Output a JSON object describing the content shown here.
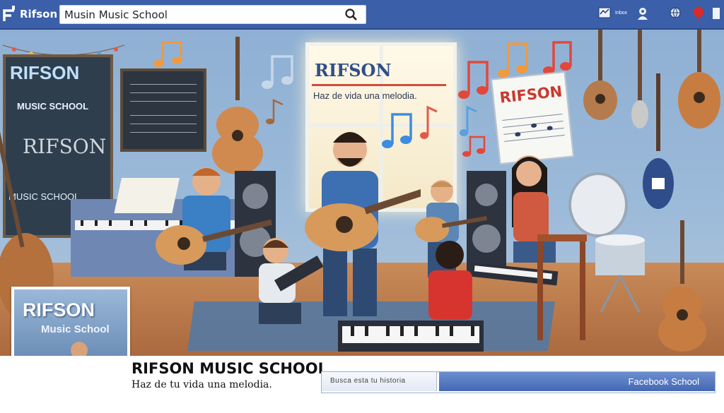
{
  "topbar": {
    "brand": "Rifson",
    "search_value": "Musin Music School",
    "nav_label": "Inbox"
  },
  "cover": {
    "window_title": "RIFSON",
    "window_tagline": "Haz de vida una melodia.",
    "chalkboard_title": "RIFSON",
    "chalkboard_subtitle": "MUSIC SCHOOL",
    "chalkboard_scribble": "RIFSON",
    "chalkboard_footer": "MUSIC SCHOOL",
    "sign_text": "RIFSON"
  },
  "profile": {
    "title": "RIFSON",
    "subtitle": "Music School"
  },
  "info": {
    "page_name": "RIFSON MUSIC SCHOOL",
    "tagline": "Haz de tu vida una melodia.",
    "field_placeholder": "Busca esta tu historia",
    "field_label": "Facebook School"
  },
  "colors": {
    "topbar": "#3b5fa8",
    "accent_red": "#c9392e",
    "link_blue": "#4468b3"
  }
}
